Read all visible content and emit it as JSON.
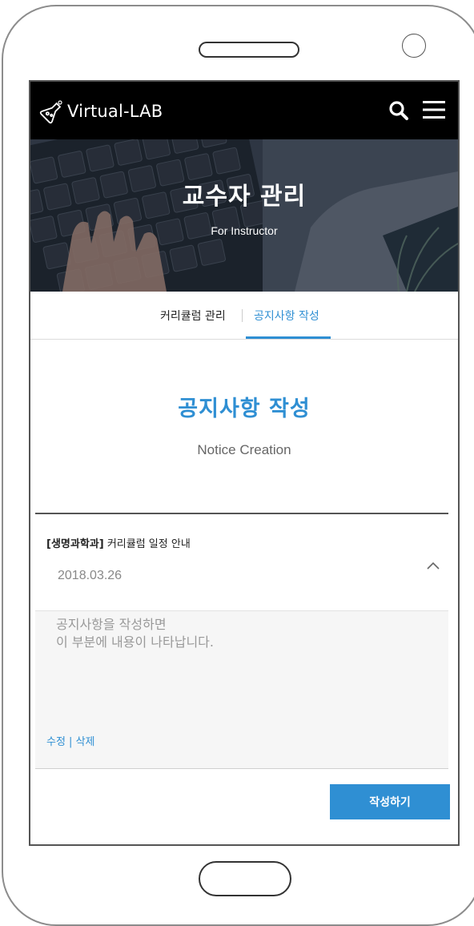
{
  "header": {
    "brand": "Virtual-LAB",
    "icons": [
      "flask-logo-icon",
      "search-icon",
      "menu-icon"
    ]
  },
  "hero": {
    "title": "교수자 관리",
    "subtitle": "For Instructor"
  },
  "tabs": [
    {
      "label": "커리큘럼 관리",
      "active": false
    },
    {
      "label": "공지사항 작성",
      "active": true
    }
  ],
  "section": {
    "title": "공지사항 작성",
    "subtitle": "Notice Creation"
  },
  "notice": {
    "category": "[생명과학과]",
    "title": "커리큘럼 일정 안내",
    "date": "2018.03.26",
    "content": "공지사항을 작성하면\n이 부분에 내용이 나타납니다.",
    "edit_label": "수정",
    "action_sep": " | ",
    "delete_label": "삭제"
  },
  "write_button": "작성하기",
  "colors": {
    "accent": "#2f8fd3",
    "header_bg": "#000000",
    "notice_bg": "#f6f6f6"
  }
}
